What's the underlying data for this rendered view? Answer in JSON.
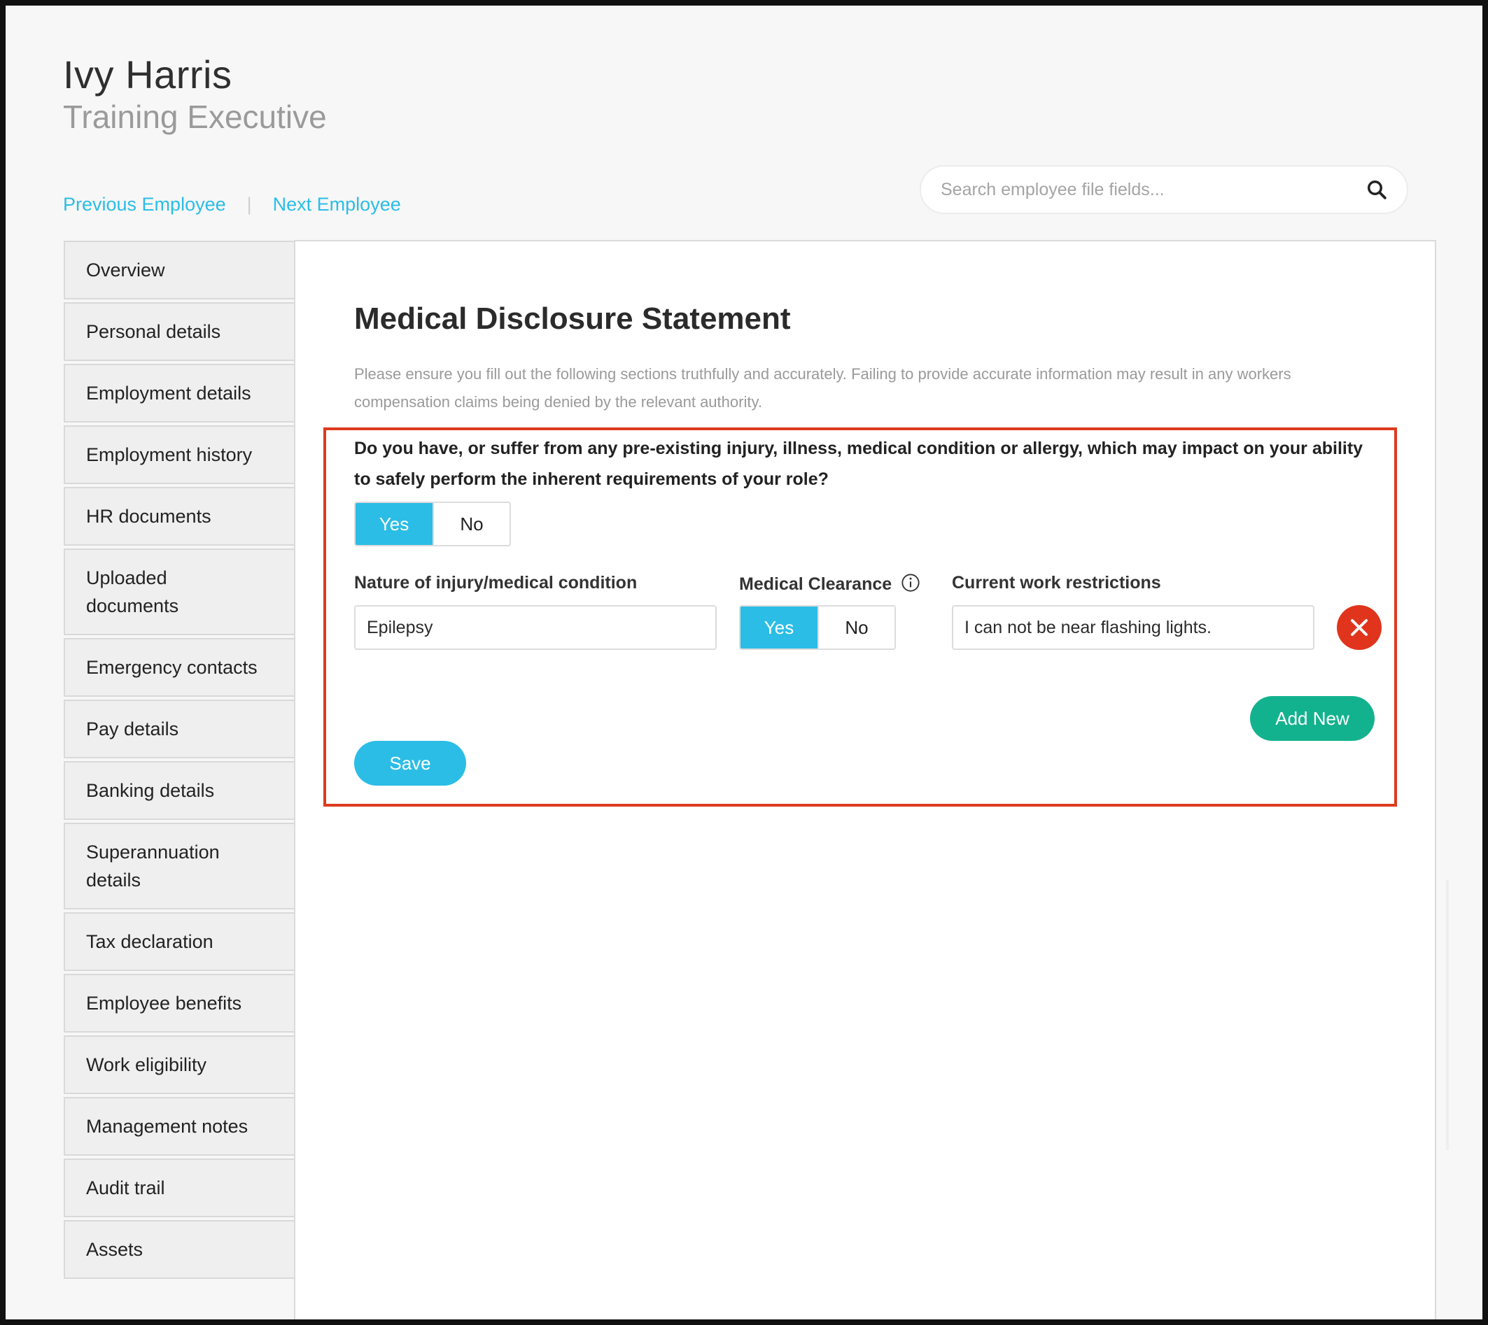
{
  "employee": {
    "name": "Ivy Harris",
    "role": "Training Executive"
  },
  "navigation": {
    "previous_label": "Previous Employee",
    "separator": "|",
    "next_label": "Next Employee"
  },
  "search": {
    "placeholder": "Search employee file fields...",
    "icon": "search-icon"
  },
  "sidebar": {
    "items": [
      {
        "label": "Overview"
      },
      {
        "label": "Personal details"
      },
      {
        "label": "Employment details"
      },
      {
        "label": "Employment history"
      },
      {
        "label": "HR documents"
      },
      {
        "label": "Uploaded documents"
      },
      {
        "label": "Emergency contacts"
      },
      {
        "label": "Pay details"
      },
      {
        "label": "Banking details"
      },
      {
        "label": "Superannuation details"
      },
      {
        "label": "Tax declaration"
      },
      {
        "label": "Employee benefits"
      },
      {
        "label": "Work eligibility"
      },
      {
        "label": "Management notes"
      },
      {
        "label": "Audit trail"
      },
      {
        "label": "Assets"
      }
    ]
  },
  "form": {
    "title": "Medical Disclosure Statement",
    "intro": "Please ensure you fill out the following sections truthfully and accurately. Failing to provide accurate information may result in any workers compensation claims being denied by the relevant authority.",
    "question": "Do you have, or suffer from any pre-existing injury, illness, medical condition or allergy, which may impact on your ability to safely perform the inherent requirements of your role?",
    "preexisting": {
      "yes_label": "Yes",
      "no_label": "No",
      "selected": "Yes"
    },
    "condition": {
      "label": "Nature of injury/medical condition",
      "value": "Epilepsy"
    },
    "clearance": {
      "label": "Medical Clearance",
      "yes_label": "Yes",
      "no_label": "No",
      "selected": "Yes"
    },
    "restrictions": {
      "label": "Current work restrictions",
      "value": "I can not be near flashing lights."
    },
    "add_label": "Add New",
    "save_label": "Save"
  },
  "colors": {
    "accent": "#2bbde6",
    "add": "#13b28e",
    "danger": "#e0341c",
    "highlight_border": "#dd3b1e"
  }
}
